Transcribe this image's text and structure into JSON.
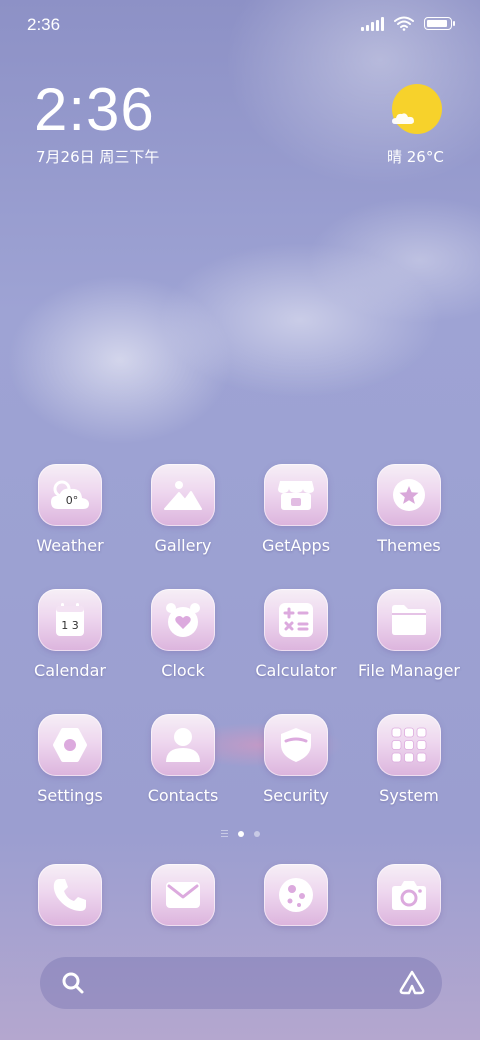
{
  "status_bar": {
    "time": "2:36",
    "icons": [
      "signal-icon",
      "wifi-icon",
      "battery-icon"
    ]
  },
  "clock_widget": {
    "time": "2:36",
    "date": "7月26日 周三下午"
  },
  "weather_widget": {
    "condition_temp": "晴 26°C",
    "icon": "sun-icon"
  },
  "weather_tile_text": "0°",
  "calendar_tile_text": "1 3",
  "apps": [
    {
      "label": "Weather",
      "icon": "weather-icon"
    },
    {
      "label": "Gallery",
      "icon": "gallery-icon"
    },
    {
      "label": "GetApps",
      "icon": "store-icon"
    },
    {
      "label": "Themes",
      "icon": "themes-icon"
    },
    {
      "label": "Calendar",
      "icon": "calendar-icon"
    },
    {
      "label": "Clock",
      "icon": "alarm-clock-icon"
    },
    {
      "label": "Calculator",
      "icon": "calculator-icon"
    },
    {
      "label": "File Manager",
      "icon": "folder-icon"
    },
    {
      "label": "Settings",
      "icon": "settings-icon"
    },
    {
      "label": "Contacts",
      "icon": "person-icon"
    },
    {
      "label": "Security",
      "icon": "shield-icon"
    },
    {
      "label": "System",
      "icon": "app-folder-icon"
    }
  ],
  "page_indicator": {
    "pages": 2,
    "active": 0
  },
  "dock": [
    {
      "icon": "phone-icon"
    },
    {
      "icon": "mail-icon"
    },
    {
      "icon": "browser-icon"
    },
    {
      "icon": "camera-icon"
    }
  ],
  "search_bar": {
    "left_icon": "search-icon",
    "right_icon": "assistant-icon"
  },
  "colors": {
    "sun": "#f7d22b",
    "icon_tile_top": "#f6eff6",
    "icon_tile_bottom": "#dcb4dd",
    "icon_glyph": "#ffffff"
  }
}
